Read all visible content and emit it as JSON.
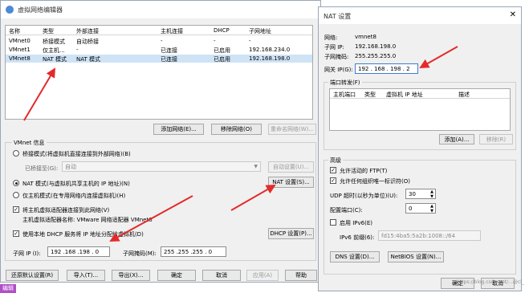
{
  "left": {
    "title": "虚拟网络编辑器",
    "columns": [
      "名称",
      "类型",
      "外部连接",
      "主机连接",
      "DHCP",
      "子网地址"
    ],
    "rows": [
      [
        "VMnet0",
        "桥接模式",
        "自动桥接",
        "-",
        "-",
        "-"
      ],
      [
        "VMnet1",
        "仅主机...",
        "-",
        "已连接",
        "已启用",
        "192.168.234.0"
      ],
      [
        "VMnet8",
        "NAT 模式",
        "NAT 模式",
        "已连接",
        "已启用",
        "192.168.198.0"
      ]
    ],
    "btn_add": "添加网络(E)...",
    "btn_remove": "移除网络(O)",
    "btn_rename": "重命名网络(W)...",
    "vmnet_info": "VMnet 信息",
    "radio_bridge": "桥接模式(将虚拟机直接连接到外部网络)(B)",
    "bridged_to_label": "已桥接至(G):",
    "bridged_to_value": "自动",
    "btn_auto": "自动设置(U)...",
    "radio_nat": "NAT 模式(与虚拟机共享主机的 IP 地址)(N)",
    "btn_nat": "NAT 设置(S)...",
    "radio_host": "仅主机模式(在专用网络内连接虚拟机)(H)",
    "chk_connect": "将主机虚拟适配器连接到此网络(V)",
    "adapter_name": "主机虚拟适配器名称: VMware 网络适配器 VMnet8",
    "chk_dhcp": "使用本地 DHCP 服务将 IP 地址分配给虚拟机(D)",
    "btn_dhcp": "DHCP 设置(P)...",
    "subnet_ip_label": "子网 IP (I):",
    "subnet_ip_value": "192 .168 .198 . 0",
    "subnet_mask_label": "子网掩码(M):",
    "subnet_mask_value": "255 .255 .255 . 0",
    "btn_restore": "还原默认设置(R)",
    "btn_import": "导入(T)...",
    "btn_export": "导出(X)...",
    "btn_ok": "确定",
    "btn_cancel": "取消",
    "btn_apply": "应用(A)",
    "btn_help": "帮助",
    "corner_tag": "编辑"
  },
  "right": {
    "title": "NAT 设置",
    "network_label": "网络:",
    "network_value": "vmnet8",
    "subnet_ip_label": "子网 IP:",
    "subnet_ip_value": "192.168.198.0",
    "subnet_mask_label": "子网掩码:",
    "subnet_mask_value": "255.255.255.0",
    "gateway_label": "网关 IP(G):",
    "gateway_value": "192 . 168 . 198 . 2",
    "port_fwd": "端口转发(F)",
    "port_columns": [
      "主机端口",
      "类型",
      "虚拟机 IP 地址",
      "描述"
    ],
    "btn_add": "添加(A)...",
    "btn_remove": "移除(R)",
    "advanced": "高级",
    "chk_ftp": "允许活动的 FTP(T)",
    "chk_oui": "允许任何组织唯一标识符(O)",
    "udp_label": "UDP 超时(以秒为单位)(U):",
    "udp_value": "30",
    "config_port_label": "配置端口(C):",
    "config_port_value": "0",
    "chk_ipv6": "启用 IPv6(E)",
    "ipv6_label": "IPv6 前缀(6):",
    "ipv6_value": "fd15:4ba5:5a2b:1008::/64",
    "btn_dns": "DNS 设置(D)...",
    "btn_netbios": "NetBIOS 设置(N)...",
    "btn_ok": "确定",
    "btn_cancel": "取消",
    "watermark": "https://blog.csdn.net/...@cl_"
  }
}
